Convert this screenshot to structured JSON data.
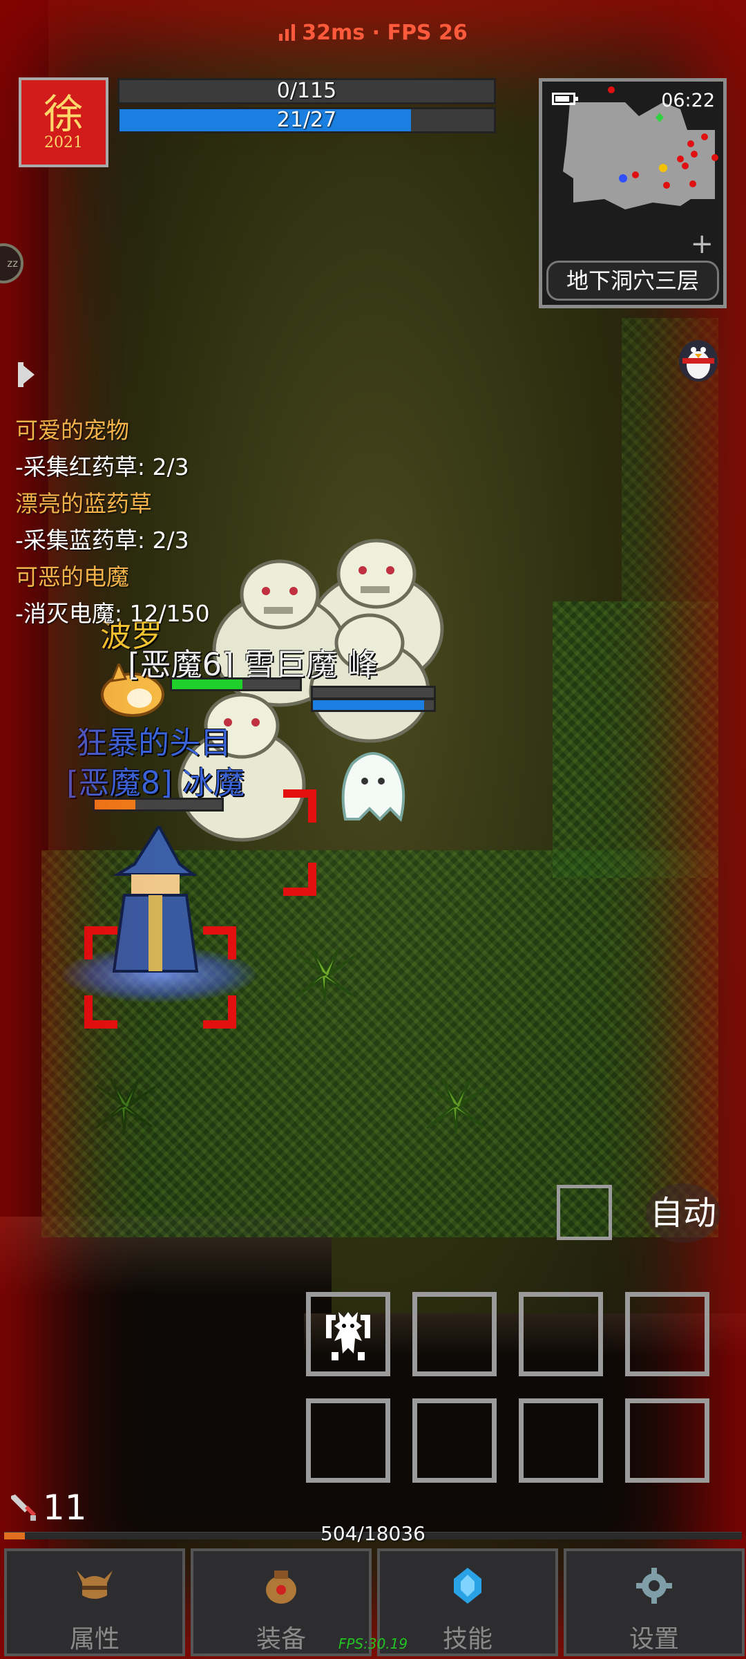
{
  "network": {
    "latency": "32ms",
    "separator": "·",
    "fps": "FPS 26"
  },
  "player": {
    "portrait_glyph": "徐",
    "portrait_year": "2021",
    "hp_text": "0/115",
    "hp_fraction": 0.0,
    "mp_text": "21/27",
    "mp_fraction": 0.7778,
    "level": "11",
    "xp_text": "504/18036",
    "xp_fraction": 0.028
  },
  "minimap": {
    "time": "06:22",
    "location": "地下洞穴三层",
    "plus_icon": "plus-icon",
    "battery_icon": "battery-icon"
  },
  "side": {
    "sleep_icon": "zzz-icon",
    "sleep_text": "zz",
    "quest_toggle_icon": "play-arrow-icon"
  },
  "quests": [
    {
      "title": "可爱的宠物",
      "task": "-采集红药草: 2/3"
    },
    {
      "title": "漂亮的蓝药草",
      "task": "-采集蓝药草: 2/3"
    },
    {
      "title": "可恶的电魔",
      "task": "-消灭电魔: 12/150"
    }
  ],
  "entities": {
    "pet_name": "波罗",
    "boss_group_label": "[恶魔6] 雪巨魔 峰",
    "boss_group_hp": 0.55,
    "boss_group_mp": 0.92,
    "elite_title": "狂暴的头目",
    "elite_name": "[恶魔8] 冰魔",
    "elite_hp": 0.32
  },
  "actions": {
    "auto_label": "自动",
    "skill_slots": [
      "demon-skill-icon",
      "",
      "",
      "",
      "",
      "",
      "",
      ""
    ]
  },
  "nav": [
    {
      "label": "属性",
      "icon": "helmet-icon"
    },
    {
      "label": "装备",
      "icon": "bag-icon"
    },
    {
      "label": "技能",
      "icon": "crystal-icon"
    },
    {
      "label": "设置",
      "icon": "gear-icon"
    }
  ],
  "fps_overlay": "FPS:30.19",
  "colors": {
    "quest_title": "#f3b34a",
    "mp": "#1a7fe0",
    "xp": "#e0701d",
    "elite_name": "#3a63d8",
    "pet_name": "#f2c531",
    "target": "#e31010"
  }
}
